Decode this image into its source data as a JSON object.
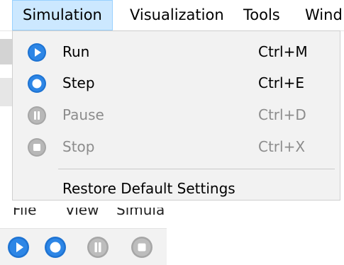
{
  "menubar": {
    "items": [
      "Simulation",
      "Visualization",
      "Tools",
      "Wind"
    ]
  },
  "simulation_menu": {
    "items": [
      {
        "label": "Run",
        "shortcut": "Ctrl+M",
        "icon": "run-icon",
        "enabled": true
      },
      {
        "label": "Step",
        "shortcut": "Ctrl+E",
        "icon": "step-icon",
        "enabled": true
      },
      {
        "label": "Pause",
        "shortcut": "Ctrl+D",
        "icon": "pause-icon",
        "enabled": false
      },
      {
        "label": "Stop",
        "shortcut": "Ctrl+X",
        "icon": "stop-icon",
        "enabled": false
      }
    ],
    "footer_item": "Restore Default Settings"
  },
  "toolbar": {
    "menu_cut_labels": [
      "File",
      "View",
      "Simula"
    ],
    "buttons": [
      {
        "icon": "run-icon",
        "enabled": true
      },
      {
        "icon": "step-icon",
        "enabled": true
      },
      {
        "icon": "pause-icon",
        "enabled": false
      },
      {
        "icon": "stop-icon",
        "enabled": false
      }
    ]
  },
  "colors": {
    "accent_blue": "#1e73d2",
    "menu_highlight": "#cce8ff",
    "disabled_gray": "#9a9a9a"
  }
}
